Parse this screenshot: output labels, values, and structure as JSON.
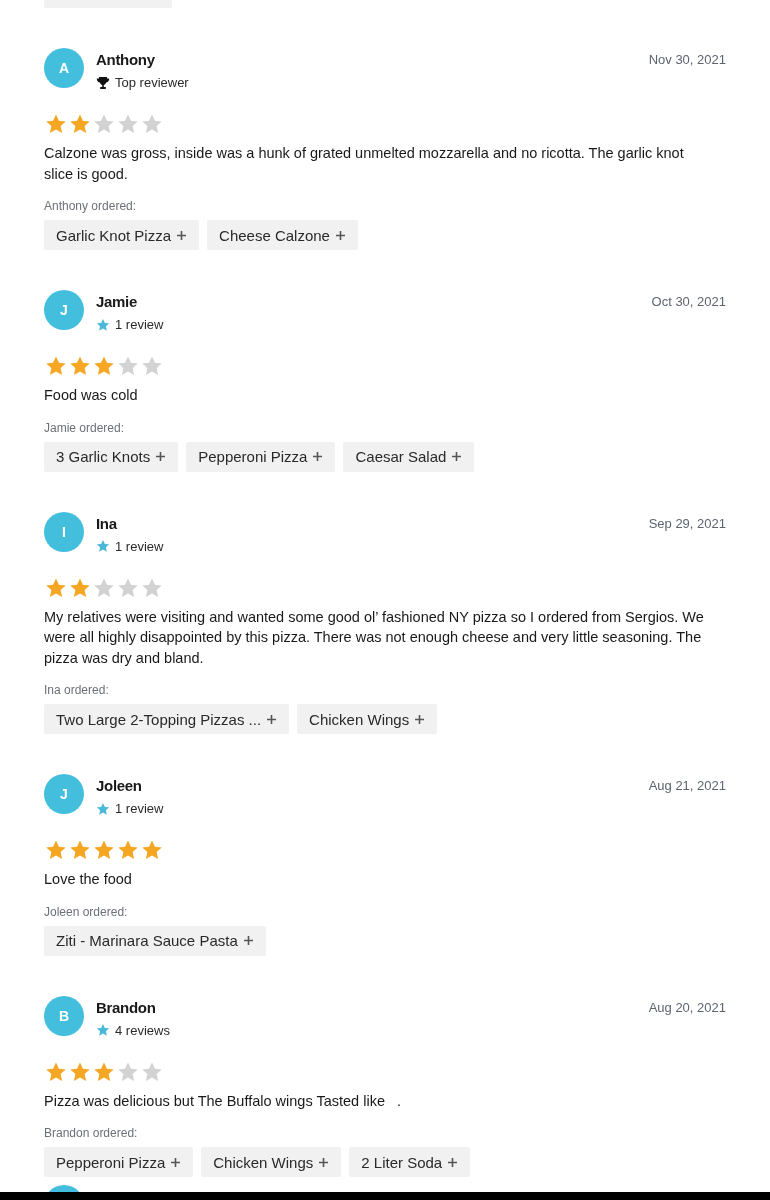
{
  "reviews": [
    {
      "initial": "A",
      "name": "Anthony",
      "badge": {
        "kind": "top_reviewer",
        "label": "Top reviewer"
      },
      "date": "Nov 30, 2021",
      "stars": 2,
      "text": "Calzone was gross, inside was a hunk of grated unmelted mozzarella and no ricotta. The garlic knot slice is good.",
      "ordered_label": "Anthony ordered:",
      "items": [
        "Garlic Knot Pizza",
        "Cheese Calzone"
      ]
    },
    {
      "initial": "J",
      "name": "Jamie",
      "badge": {
        "kind": "review_count",
        "label": "1 review"
      },
      "date": "Oct 30, 2021",
      "stars": 3,
      "text": "Food was cold",
      "ordered_label": "Jamie ordered:",
      "items": [
        "3 Garlic Knots",
        "Pepperoni Pizza",
        "Caesar Salad"
      ]
    },
    {
      "initial": "I",
      "name": "Ina",
      "badge": {
        "kind": "review_count",
        "label": "1 review"
      },
      "date": "Sep 29, 2021",
      "stars": 2,
      "text": "My relatives were visiting and wanted some good ol’ fashioned NY pizza so I ordered from Sergios. We were all highly disappointed by this pizza. There was not enough cheese and very little seasoning. The pizza was dry and bland.",
      "ordered_label": "Ina ordered:",
      "items": [
        "Two Large 2-Topping Pizzas ...",
        "Chicken Wings"
      ]
    },
    {
      "initial": "J",
      "name": "Joleen",
      "badge": {
        "kind": "review_count",
        "label": "1 review"
      },
      "date": "Aug 21, 2021",
      "stars": 5,
      "text": "Love the food",
      "ordered_label": "Joleen ordered:",
      "items": [
        "Ziti - Marinara Sauce Pasta"
      ]
    },
    {
      "initial": "B",
      "name": "Brandon",
      "badge": {
        "kind": "review_count",
        "label": "4 reviews"
      },
      "date": "Aug 20, 2021",
      "stars": 3,
      "text": "Pizza was delicious but The Buffalo wings Tasted like   .",
      "ordered_label": "Brandon ordered:",
      "items": [
        "Pepperoni Pizza",
        "Chicken Wings",
        "2 Liter Soda"
      ]
    }
  ]
}
